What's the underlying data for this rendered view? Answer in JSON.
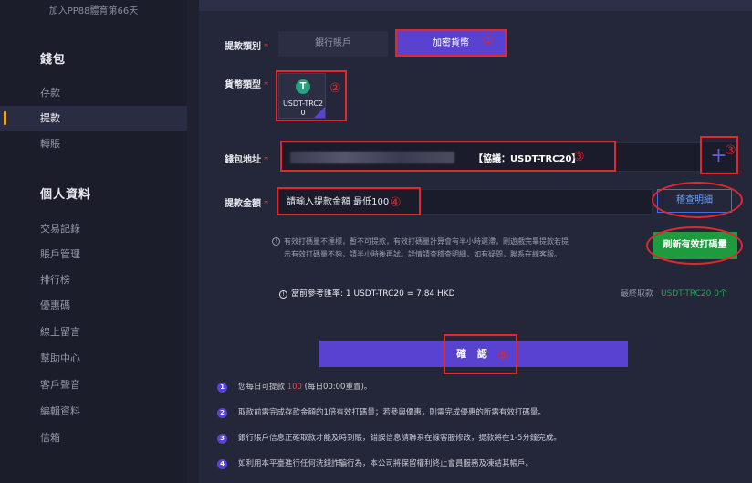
{
  "sidebar": {
    "days_text": "加入PP88體育第66天",
    "wallet_title": "錢包",
    "wallet_items": [
      {
        "label": "存款",
        "active": false
      },
      {
        "label": "提款",
        "active": true
      },
      {
        "label": "轉賬",
        "active": false
      }
    ],
    "profile_title": "個人資料",
    "profile_items": [
      {
        "label": "交易記錄"
      },
      {
        "label": "賬戶管理"
      },
      {
        "label": "排行榜"
      },
      {
        "label": "優惠碼"
      },
      {
        "label": "線上留言"
      },
      {
        "label": "幫助中心"
      },
      {
        "label": "客戶聲音"
      },
      {
        "label": "編輯資料"
      },
      {
        "label": "信箱"
      }
    ]
  },
  "form": {
    "type_label": "提款類別",
    "tab_bank": "銀行賬戶",
    "tab_crypto": "加密貨幣",
    "currency_label": "貨幣類型",
    "coin_name": "USDT-TRC20",
    "wallet_label": "錢包地址",
    "wallet_protocol": "【協議：USDT-TRC20】",
    "plus_symbol": "+",
    "amount_label": "提款金額",
    "amount_placeholder": "請輸入提款金額 最低100",
    "detail_button": "稽查明細",
    "note_line1": "有效打碼量不達標，暫不可提款，有效打碼量計算會有半小時遲滯，剛遊戲完畢提款若提",
    "note_line2": "示有效打碼量不夠，請半小時後再試。詳情請查稽查明細，如有疑問，聯系在線客服。",
    "refresh_button": "刷新有效打碼量",
    "rate_text": "當前參考匯率:  1 USDT-TRC20 = 7.84 HKD",
    "latest_label": "最終取款",
    "latest_value": "USDT-TRC20 0个",
    "confirm_button": "確 認",
    "required_mark": "*"
  },
  "rules": [
    {
      "num": "1",
      "before": "您每日可提款 ",
      "highlight": "100",
      "after": " (每日00:00重置)。"
    },
    {
      "num": "2",
      "before": "取款前需完成存款金額的1倍有效打碼量；若參與優惠，則需完成優惠的所需有效打碼量。",
      "highlight": "",
      "after": ""
    },
    {
      "num": "3",
      "before": "銀行賬戶信息正確取款才能及時到賬，錯誤信息請聯系在線客服修改，提款將在1-5分鐘完成。",
      "highlight": "",
      "after": ""
    },
    {
      "num": "4",
      "before": "如利用本平臺進行任何洗錢詐騙行為，本公司將保留權利終止會員服務及凍結其帳戶。",
      "highlight": "",
      "after": ""
    }
  ],
  "annotations": [
    "①",
    "②",
    "③",
    "④",
    "③",
    "⑤"
  ],
  "colors": {
    "accent": "#5842cf",
    "green": "#1e9b3e",
    "annotation_red": "#e0282e",
    "active_marker": "#e0a32e"
  }
}
